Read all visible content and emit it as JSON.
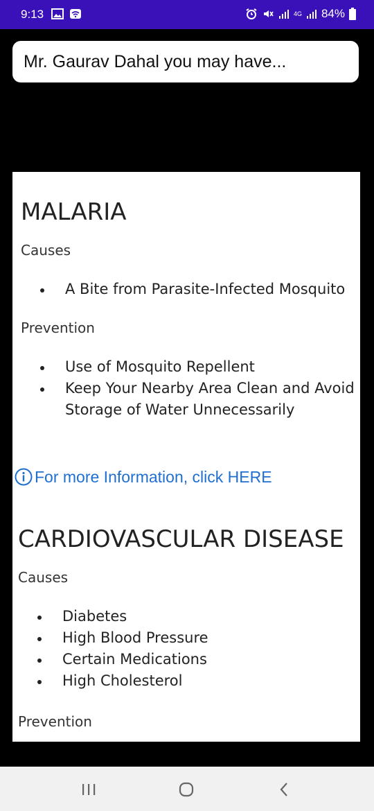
{
  "status_bar": {
    "time": "9:13",
    "battery_percent": "84%",
    "left_icons": [
      "gallery-icon",
      "wifi-icon"
    ],
    "right_icons": [
      "alarm-icon",
      "mute-icon",
      "signal-icon",
      "4g-icon",
      "signal-icon",
      "battery-icon"
    ],
    "network_label": "4G",
    "background_color": "#3a10b8"
  },
  "header": {
    "message": "Mr. Gaurav Dahal you may have..."
  },
  "sections": [
    {
      "title": "MALARIA",
      "causes_label": "Causes",
      "causes": [
        "A Bite from Parasite-Infected Mosquito"
      ],
      "prevention_label": "Prevention",
      "prevention": [
        "Use of Mosquito Repellent",
        "Keep Your Nearby Area Clean and Avoid",
        "Storage of Water Unnecessarily"
      ]
    },
    {
      "title": "CARDIOVASCULAR DISEASE",
      "causes_label": "Causes",
      "causes": [
        "Diabetes",
        "High Blood Pressure",
        "Certain Medications",
        "High Cholesterol"
      ],
      "prevention_label": "Prevention"
    }
  ],
  "info_link": {
    "text": "For more Information, click HERE",
    "color": "#1f6fd1"
  },
  "nav_bar": {
    "buttons": [
      "recent-apps-icon",
      "home-icon",
      "back-icon"
    ]
  }
}
